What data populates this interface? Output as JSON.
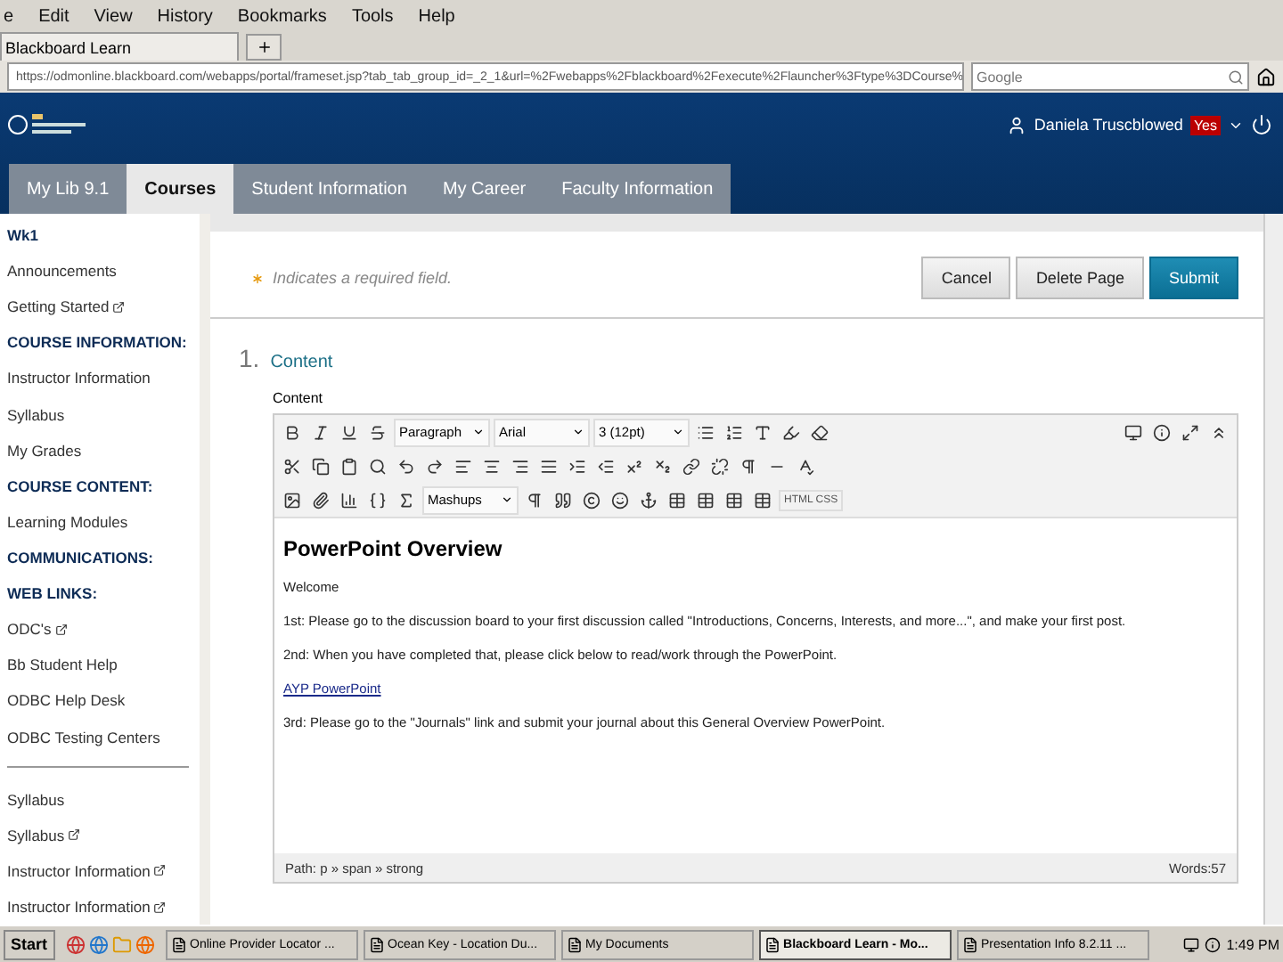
{
  "browser": {
    "menu": [
      "e",
      "Edit",
      "View",
      "History",
      "Bookmarks",
      "Tools",
      "Help"
    ],
    "tab_title": "Blackboard Learn",
    "url": "https://odmonline.blackboard.com/webapps/portal/frameset.jsp?tab_tab_group_id=_2_1&url=%2Fwebapps%2Fblackboard%2Fexecute%2Flauncher%3Ftype%3DCourse%",
    "search_placeholder": "Google"
  },
  "header": {
    "user": "Daniela Truscblowed",
    "badge": "Yes"
  },
  "tabs": [
    {
      "label": "My Lib 9.1",
      "selected": false
    },
    {
      "label": "Courses",
      "selected": true
    },
    {
      "label": "Student Information",
      "selected": false
    },
    {
      "label": "My Career",
      "selected": false
    },
    {
      "label": "Faculty Information",
      "selected": false
    }
  ],
  "sidebar": {
    "items": [
      {
        "label": "Wk1",
        "kind": "heading",
        "external": false
      },
      {
        "label": "Announcements",
        "kind": "link",
        "external": false
      },
      {
        "label": "Getting Started",
        "kind": "link",
        "external": true
      },
      {
        "label": "COURSE INFORMATION:",
        "kind": "heading",
        "external": false
      },
      {
        "label": "Instructor Information",
        "kind": "link",
        "external": false
      },
      {
        "label": "Syllabus",
        "kind": "link",
        "external": false
      },
      {
        "label": "My Grades",
        "kind": "link",
        "external": false
      },
      {
        "label": "COURSE CONTENT:",
        "kind": "heading",
        "external": false
      },
      {
        "label": "Learning Modules",
        "kind": "link",
        "external": false
      },
      {
        "label": "COMMUNICATIONS:",
        "kind": "heading",
        "external": false
      },
      {
        "label": "WEB LINKS:",
        "kind": "heading",
        "external": false
      },
      {
        "label": "ODC's",
        "kind": "link",
        "external": true
      },
      {
        "label": "Bb Student Help",
        "kind": "link",
        "external": false
      },
      {
        "label": "ODBC Help Desk",
        "kind": "link",
        "external": false
      },
      {
        "label": "ODBC Testing Centers",
        "kind": "link",
        "external": false
      }
    ],
    "lower_items": [
      {
        "label": "Syllabus",
        "external": false
      },
      {
        "label": "Syllabus",
        "external": true
      },
      {
        "label": "Instructor Information",
        "external": true
      },
      {
        "label": "Instructor Information",
        "external": true
      }
    ]
  },
  "form": {
    "required_note": "Indicates a required field.",
    "buttons": [
      {
        "label": "Cancel",
        "kind": "plain"
      },
      {
        "label": "Delete Page",
        "kind": "plain"
      },
      {
        "label": "Submit",
        "kind": "primary"
      }
    ],
    "step_number": "1.",
    "step_title": "Content",
    "field_label": "Content"
  },
  "editor": {
    "dropdowns": [
      "Paragraph",
      "Arial",
      "3 (12pt)"
    ],
    "mashups": "Mashups",
    "html_label": "HTML CSS",
    "heading": "PowerPoint Overview",
    "paragraphs": [
      {
        "text": "Welcome",
        "kind": "text"
      },
      {
        "text": "1st: Please go to the discussion board to your first discussion called \"Introductions, Concerns, Interests, and more...\", and make your first post.",
        "kind": "text"
      },
      {
        "text": "2nd: When you have completed that, please click below to read/work through the PowerPoint.",
        "kind": "text"
      },
      {
        "text": "AYP PowerPoint",
        "kind": "link"
      },
      {
        "text": "3rd: Please go to the \"Journals\" link and submit your journal about this General Overview PowerPoint.",
        "kind": "text"
      }
    ],
    "path": "Path: p » span » strong",
    "words": "Words:57"
  },
  "taskbar": {
    "start": "Start",
    "windows": [
      {
        "label": "Online Provider Locator ...",
        "selected": false
      },
      {
        "label": "Ocean Key - Location Du...",
        "selected": false
      },
      {
        "label": "My Documents",
        "selected": false
      },
      {
        "label": "Blackboard Learn - Mo...",
        "selected": true
      },
      {
        "label": "Presentation Info 8.2.11 ...",
        "selected": false
      }
    ],
    "clock": "1:49 PM"
  }
}
